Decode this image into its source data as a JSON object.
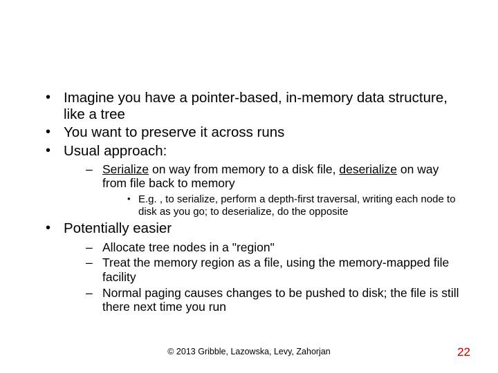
{
  "bullets": {
    "b1": "Imagine you have a pointer-based, in-memory data structure, like a tree",
    "b2": "You want to preserve it across runs",
    "b3": "Usual approach:",
    "b3_1_pre": "Serialize",
    "b3_1_mid": " on way from memory to a disk file, ",
    "b3_1_u2": "deserialize",
    "b3_1_post": " on way from file back to memory",
    "b3_1_1": "E.g. , to serialize, perform a depth-first traversal, writing each node to disk as you go; to deserialize, do the opposite",
    "b4": "Potentially easier",
    "b4_1": "Allocate tree nodes in a \"region\"",
    "b4_2": "Treat the memory region as a file, using the memory-mapped file facility",
    "b4_3": "Normal paging causes changes to be pushed to disk; the file is still there next time you run"
  },
  "footer": "© 2013 Gribble, Lazowska, Levy, Zahorjan",
  "page": "22"
}
